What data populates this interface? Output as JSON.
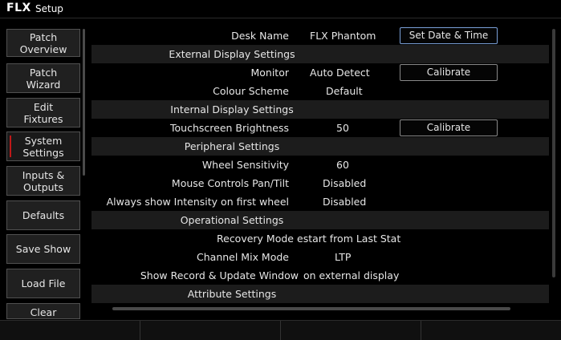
{
  "titlebar": {
    "logo": "FLX",
    "title": "Setup"
  },
  "sidebar": {
    "items": [
      {
        "label": "Patch Overview"
      },
      {
        "label": "Patch Wizard"
      },
      {
        "label": "Edit Fixtures"
      },
      {
        "label": "System Settings",
        "active": true,
        "accent_color": "#c01818"
      },
      {
        "label": "Inputs & Outputs"
      },
      {
        "label": "Defaults"
      },
      {
        "label": "Save Show"
      },
      {
        "label": "Load File"
      },
      {
        "label": "Clear"
      }
    ]
  },
  "settings": {
    "desk_name": {
      "label": "Desk Name",
      "value": "FLX Phantom",
      "button": "Set Date & Time"
    },
    "external_display_header": "External Display Settings",
    "monitor": {
      "label": "Monitor",
      "value": "Auto Detect",
      "button": "Calibrate"
    },
    "colour_scheme": {
      "label": "Colour Scheme",
      "value": "Default"
    },
    "internal_display_header": "Internal Display Settings",
    "touchscreen_brightness": {
      "label": "Touchscreen Brightness",
      "value": "50",
      "button": "Calibrate"
    },
    "peripheral_header": "Peripheral Settings",
    "wheel_sensitivity": {
      "label": "Wheel Sensitivity",
      "value": "60"
    },
    "mouse_pan_tilt": {
      "label": "Mouse Controls Pan/Tilt",
      "value": "Disabled"
    },
    "intensity_first_wheel": {
      "label": "Always show Intensity on first wheel",
      "value": "Disabled"
    },
    "operational_header": "Operational Settings",
    "recovery_mode": {
      "label": "Recovery Mode",
      "value": "estart from Last Stat"
    },
    "channel_mix_mode": {
      "label": "Channel Mix Mode",
      "value": "LTP"
    },
    "show_record_window": {
      "label": "Show Record & Update Window",
      "value": "on external display"
    },
    "attribute_header": "Attribute Settings"
  },
  "colors": {
    "background": "#000000",
    "row_band": "#1c1c1c",
    "button_border": "#888888",
    "focus_border": "#7aa0d8"
  }
}
